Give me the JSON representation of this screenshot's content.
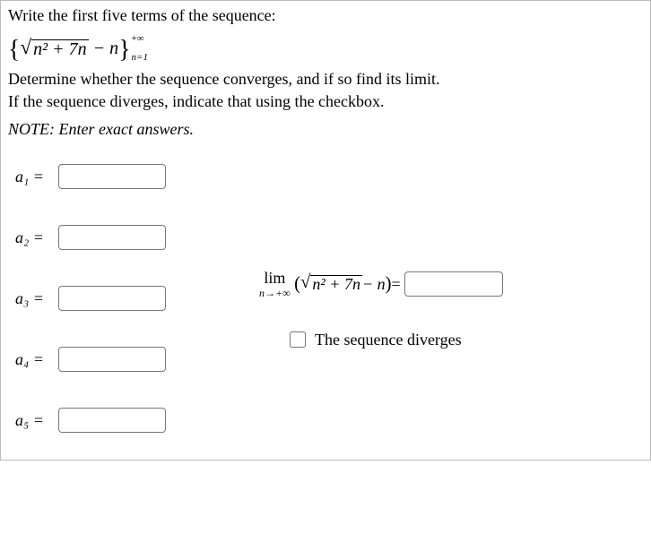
{
  "prompt": "Write the first five terms of the sequence:",
  "sequence": {
    "inner": "n² + 7n",
    "minus": " − n",
    "sup": "+∞",
    "sub": "n=1"
  },
  "instructions_l1": "Determine whether the sequence converges, and if so find its limit.",
  "instructions_l2": "If the sequence diverges, indicate that using the checkbox.",
  "note": "NOTE:  Enter exact answers.",
  "terms": {
    "a1": "a₁ =",
    "a2": "a₂ =",
    "a3": "a₃ =",
    "a4": "a₄ =",
    "a5": "a₅ ="
  },
  "limit": {
    "lim": "lim",
    "approach": "n→+∞",
    "inner": "n² + 7n",
    "minus": " − n",
    "equals": " ="
  },
  "diverges_label": "The sequence diverges",
  "values": {
    "a1": "",
    "a2": "",
    "a3": "",
    "a4": "",
    "a5": "",
    "limit": ""
  }
}
